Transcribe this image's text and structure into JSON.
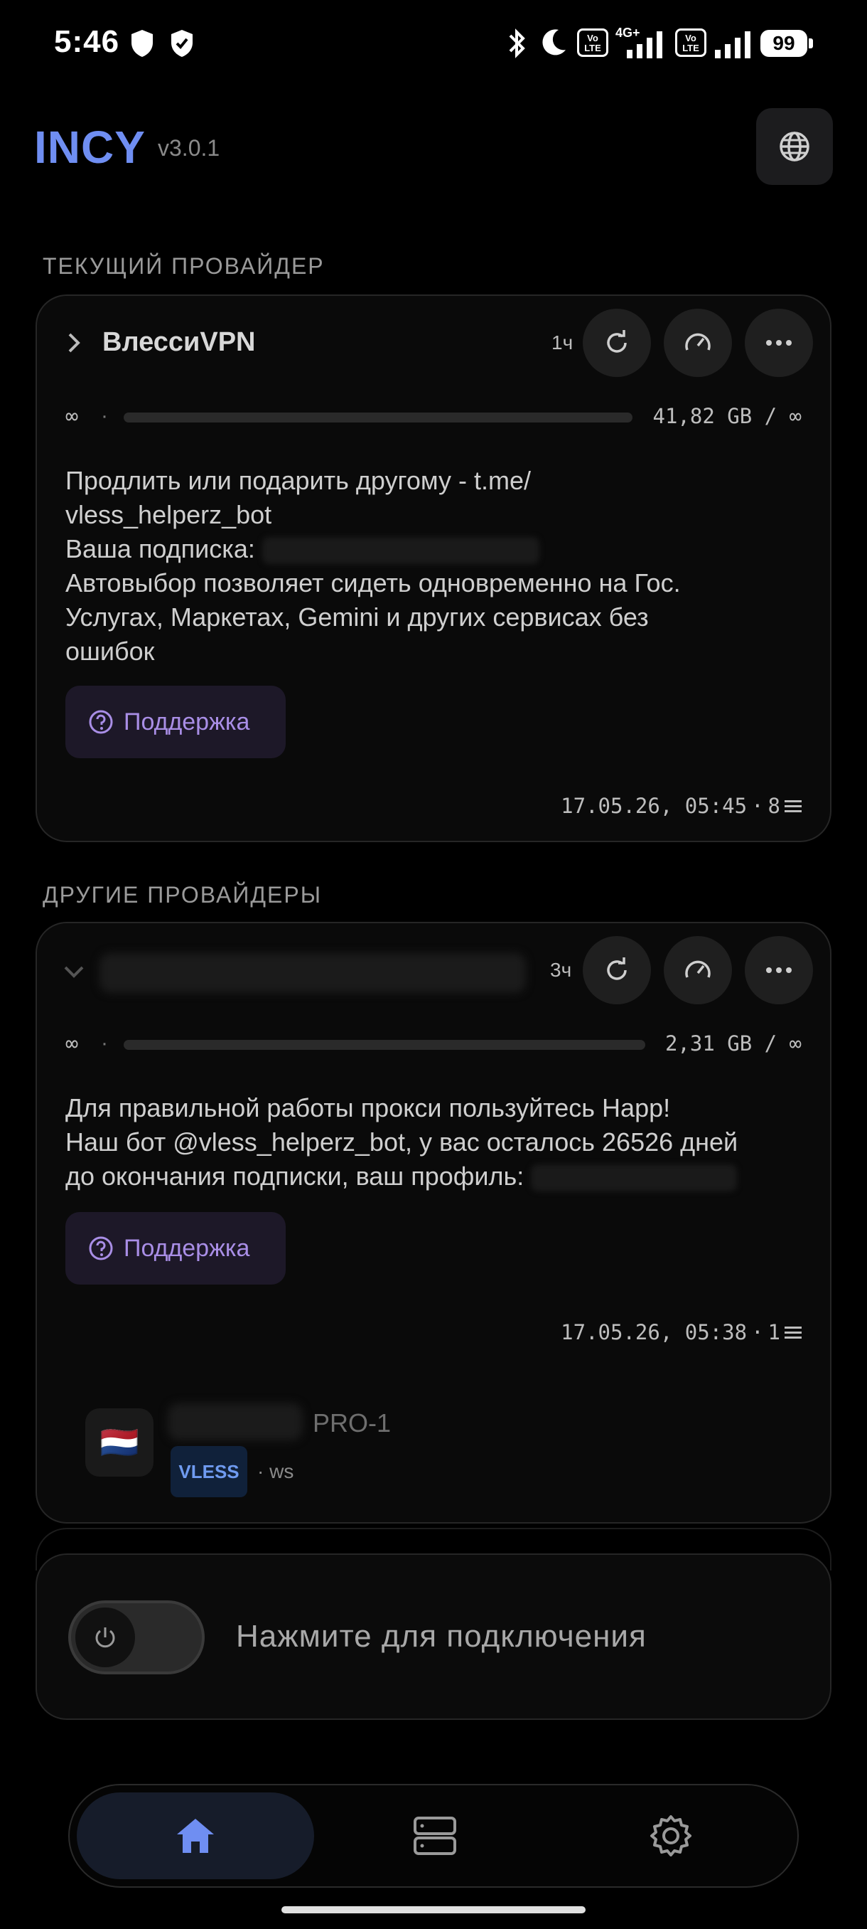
{
  "status_bar": {
    "time": "5:46",
    "network": "4G+",
    "battery": "99"
  },
  "header": {
    "brand": "INCY",
    "version": "v3.0.1"
  },
  "current_provider": {
    "section_title": "ТЕКУЩИЙ ПРОВАЙДЕР",
    "name": "ВлессиVPN",
    "age": "1ч",
    "limit": "∞",
    "traffic": "41,82 GB / ∞",
    "description": "Продлить или подарить другому - t.me/ vless_helperz_bot Ваша подписка: dymo... Автовыбор позволяет сидеть одновременно на Гос. Услугах, Маркетах, Gemini и других сервисах без ошибок",
    "desc_lines": [
      "Продлить или подарить другому - t.me/",
      "vless_helperz_bot",
      "Ваша подписка:",
      "Автовыбор позволяет сидеть одновременно на Гос.",
      "Услугах, Маркетах, Gemini и других сервисах без",
      "ошибок"
    ],
    "support_label": "Поддержка",
    "updated": "17.05.26, 05:45",
    "server_count": "8"
  },
  "other_providers": {
    "section_title": "ДРУГИЕ ПРОВАЙДЕРЫ",
    "age": "3ч",
    "limit": "∞",
    "traffic": "2,31 GB / ∞",
    "desc_lines": [
      "Для правильной работы прокси пользуйтесь Happ!",
      "Наш бот @vless_helperz_bot, у вас осталось 26526 дней",
      "до окончания подписки, ваш профиль:"
    ],
    "support_label": "Поддержка",
    "updated": "17.05.26, 05:38",
    "server_count": "1",
    "server": {
      "name_suffix": "PRO-1",
      "protocol": "VLESS",
      "transport": "· ws",
      "flag": "🇳🇱"
    }
  },
  "connect": {
    "label": "Нажмите для подключения"
  },
  "colors": {
    "accent": "#6f8ef2",
    "support_text": "#a98ee6",
    "background": "#000000"
  }
}
